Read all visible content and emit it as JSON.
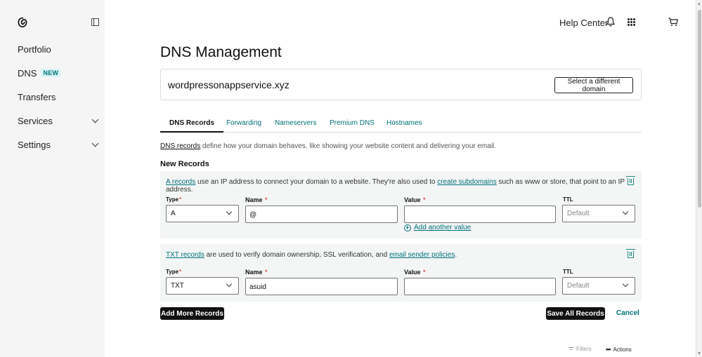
{
  "sidebar": {
    "logo_icon": "godaddy-logo-icon",
    "items": [
      {
        "label": "Portfolio"
      },
      {
        "label": "DNS",
        "badge": "NEW"
      },
      {
        "label": "Transfers"
      },
      {
        "label": "Services"
      },
      {
        "label": "Settings"
      }
    ]
  },
  "topbar": {
    "help": "Help Center"
  },
  "page": {
    "title": "DNS Management",
    "domain": "wordpressonappservice.xyz",
    "select_domain": "Select a different domain"
  },
  "tabs": [
    "DNS Records",
    "Forwarding",
    "Nameservers",
    "Premium DNS",
    "Hostnames"
  ],
  "intro": {
    "link": "DNS records",
    "text": " define how your domain behaves, like showing your website content and delivering your email."
  },
  "new_records": {
    "title": "New Records",
    "a_record": {
      "link1": "A records",
      "text1": " use an IP address to connect your domain to a website. They're also used to ",
      "link2": "create subdomains",
      "text2": " such as www or store, that point to an IP address.",
      "type_label": "Type",
      "type_value": "A",
      "name_label": "Name",
      "name_value": "@",
      "value_label": "Value",
      "value_value": "",
      "ttl_label": "TTL",
      "ttl_value": "Default",
      "add_value": "Add another value"
    },
    "txt_record": {
      "link1": "TXT records",
      "text1": " are used to verify domain ownership, SSL verification, and ",
      "link2": "email sender policies",
      "text2": ".",
      "type_label": "Type",
      "type_value": "TXT",
      "name_label": "Name",
      "name_value": "asuid",
      "value_label": "Value",
      "value_value": "",
      "ttl_label": "TTL",
      "ttl_value": "Default"
    },
    "required_mark": "*"
  },
  "buttons": {
    "add_more": "Add More Records",
    "save_all": "Save All Records",
    "cancel": "Cancel"
  },
  "footer": {
    "filters": "Filters",
    "actions": "Actions",
    "dots": "•••"
  },
  "colors": {
    "accent": "#00727a",
    "sidebar_bg": "#f5f5f5",
    "card_bg": "#f4f5f5"
  }
}
